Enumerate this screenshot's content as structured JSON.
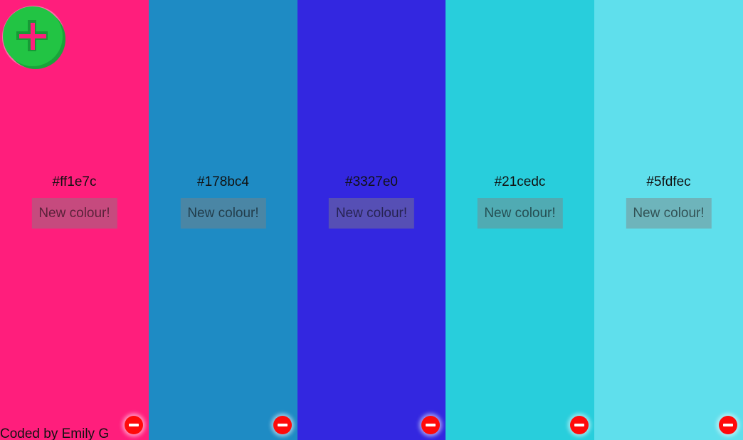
{
  "palette": {
    "columns": [
      {
        "hex": "#ff1e7c",
        "color": "#ff1e7c",
        "new_label": "New colour!"
      },
      {
        "hex": "#178bc4",
        "color": "#1e8bc4",
        "new_label": "New colour!"
      },
      {
        "hex": "#3327e0",
        "color": "#3327e0",
        "new_label": "New colour!"
      },
      {
        "hex": "#21cedc",
        "color": "#28cedc",
        "new_label": "New colour!"
      },
      {
        "hex": "#5fdfec",
        "color": "#5fdfec",
        "new_label": "New colour!"
      }
    ]
  },
  "add_button": {
    "icon": "plus-icon",
    "color": "#22c444"
  },
  "remove_button": {
    "icon": "minus-icon",
    "color": "#ff0a0a"
  },
  "footer": {
    "credit": "Coded by Emily G"
  }
}
